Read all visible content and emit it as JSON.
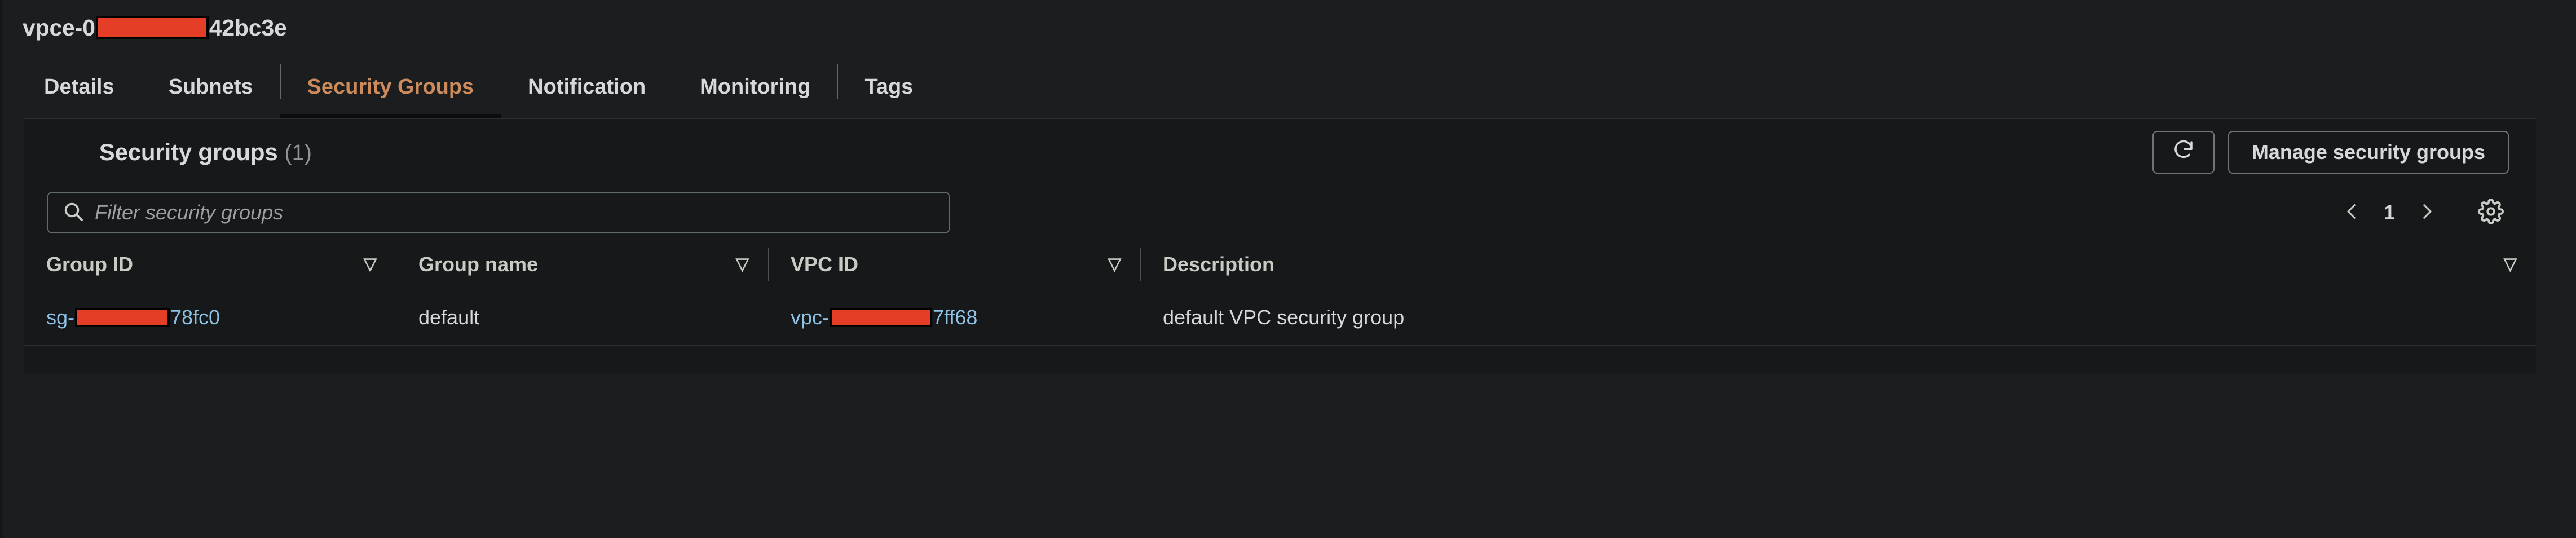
{
  "header": {
    "resource_id_prefix": "vpce-0",
    "resource_id_suffix": "42bc3e"
  },
  "tabs": [
    {
      "label": "Details",
      "active": false
    },
    {
      "label": "Subnets",
      "active": false
    },
    {
      "label": "Security Groups",
      "active": true
    },
    {
      "label": "Notification",
      "active": false
    },
    {
      "label": "Monitoring",
      "active": false
    },
    {
      "label": "Tags",
      "active": false
    }
  ],
  "panel": {
    "title": "Security groups",
    "count": "(1)",
    "refresh_icon": "refresh-icon",
    "manage_label": "Manage security groups"
  },
  "search": {
    "placeholder": "Filter security groups",
    "value": "",
    "icon": "search-icon"
  },
  "pagination": {
    "prev_icon": "chevron-left-icon",
    "page": "1",
    "next_icon": "chevron-right-icon",
    "settings_icon": "gear-icon"
  },
  "table": {
    "columns": [
      {
        "label": "Group ID",
        "sort": "▽"
      },
      {
        "label": "Group name",
        "sort": "▽"
      },
      {
        "label": "VPC ID",
        "sort": "▽"
      },
      {
        "label": "Description",
        "sort": "▽"
      }
    ],
    "rows": [
      {
        "group_id_prefix": "sg-",
        "group_id_suffix": "78fc0",
        "group_name": "default",
        "vpc_id_prefix": "vpc-",
        "vpc_id_suffix": "7ff68",
        "description": "default VPC security group"
      }
    ]
  },
  "colors": {
    "page_bg": "#1b1d1f",
    "card_bg": "#16181a",
    "text": "#d5d9d9",
    "active_tab": "#cd8b5c",
    "link": "#8ec3e6",
    "redaction": "#e53e26"
  }
}
